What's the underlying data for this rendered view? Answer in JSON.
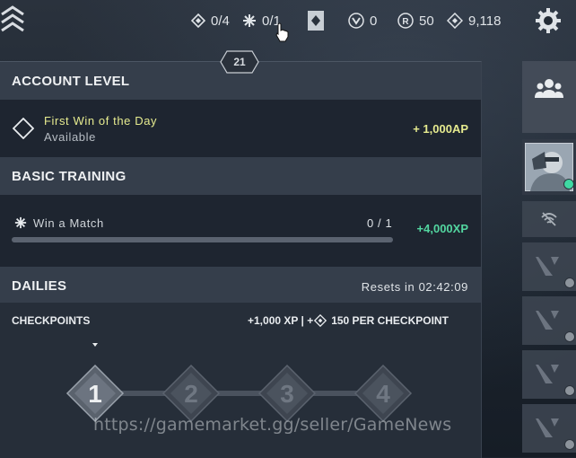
{
  "topbar": {
    "kingdom_credits": "0/4",
    "radianite_counter": "0/1",
    "valorant_points": "0",
    "radianite_points": "50",
    "kingdom_points": "9,118",
    "icons": [
      "logo-chevron-icon",
      "kingdom-credit-icon",
      "radianite-star-icon",
      "rank-diamond-icon",
      "vp-icon",
      "rp-icon",
      "kc-icon",
      "gear-icon"
    ]
  },
  "account_level": {
    "level": "21",
    "title": "ACCOUNT LEVEL",
    "item_title": "First Win of the Day",
    "item_status": "Available",
    "reward": "+ 1,000AP"
  },
  "basic_training": {
    "title": "BASIC TRAINING",
    "task": "Win a Match",
    "progress": "0 / 1",
    "progress_fraction": 0,
    "reward": "+4,000XP"
  },
  "dailies": {
    "title": "DAILIES",
    "resets": "Resets in 02:42:09",
    "checkpoints_label": "CHECKPOINTS",
    "checkpoint_reward_xp": "+1,000 XP | +",
    "checkpoint_reward_kc": "150 PER CHECKPOINT",
    "checkpoints": [
      "1",
      "2",
      "3",
      "4"
    ]
  },
  "watermark": "https://gamemarket.gg/seller/GameNews",
  "colors": {
    "yellow_reward": "#e6eb8f",
    "green_reward": "#53d6a0",
    "online": "#3fd9a3"
  }
}
